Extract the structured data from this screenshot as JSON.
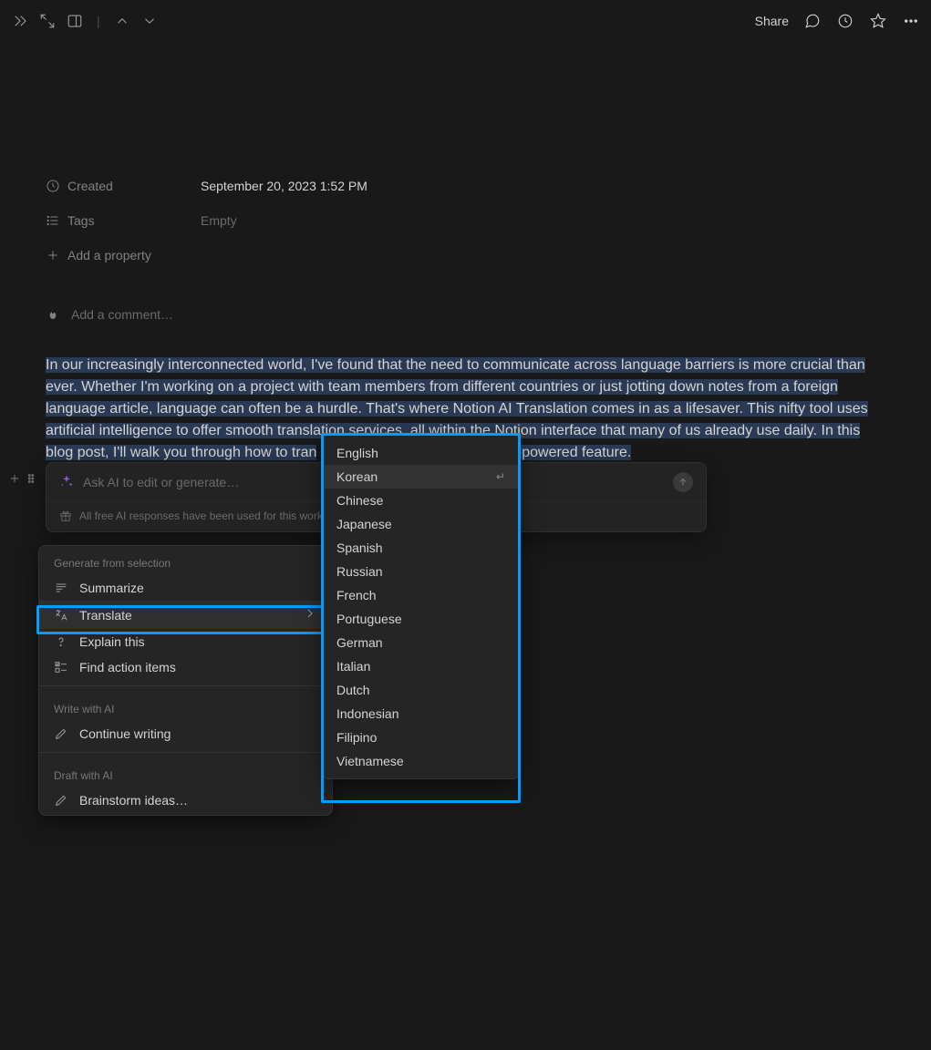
{
  "topbar": {
    "share_label": "Share"
  },
  "props": {
    "created_label": "Created",
    "created_value": "September 20, 2023 1:52 PM",
    "tags_label": "Tags",
    "tags_value": "Empty",
    "add_property_label": "Add a property"
  },
  "comment_placeholder": "Add a comment…",
  "body": {
    "selected": "In our increasingly interconnected world, I've found that the need to communicate across language barriers is more crucial than ever. Whether I'm working on a project with team members from different countries or just jotting down notes from a foreign language article, language can often be a hurdle. That's where Notion AI Translation comes in as a lifesaver. This nifty tool uses artificial intelligence to offer smooth translation services, all within the Notion interface that many of us already use daily. In this blog post, I'll walk you through how to tran",
    "after": "I-powered feature."
  },
  "ai": {
    "placeholder": "Ask AI to edit or generate…",
    "notice": "All free AI responses have been used for this works"
  },
  "menu": {
    "section_generate": "Generate from selection",
    "summarize": "Summarize",
    "translate": "Translate",
    "explain": "Explain this",
    "action_items": "Find action items",
    "section_write": "Write with AI",
    "continue_writing": "Continue writing",
    "section_draft": "Draft with AI",
    "brainstorm": "Brainstorm ideas…"
  },
  "languages": {
    "hovered": "Korean",
    "list": [
      "English",
      "Korean",
      "Chinese",
      "Japanese",
      "Spanish",
      "Russian",
      "French",
      "Portuguese",
      "German",
      "Italian",
      "Dutch",
      "Indonesian",
      "Filipino",
      "Vietnamese"
    ]
  }
}
